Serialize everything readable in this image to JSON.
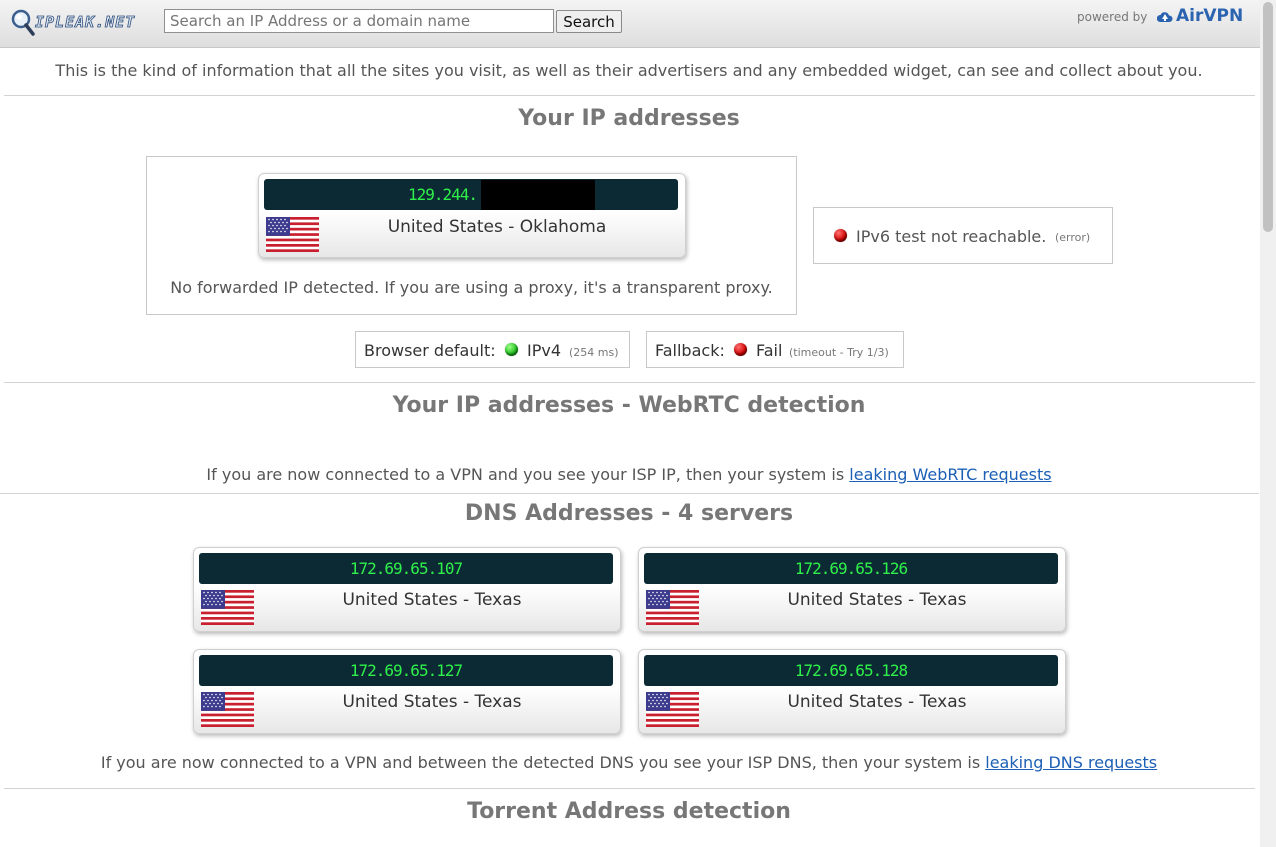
{
  "header": {
    "logo_text": "IPLEAK.NET",
    "search_placeholder": "Search an IP Address or a domain name",
    "search_button": "Search",
    "powered_by": "powered by",
    "brand": "AirVPN"
  },
  "intro": "This is the kind of information that all the sites you visit, as well as their advertisers and any embedded widget, can see and collect about you.",
  "ip_section": {
    "title": "Your IP addresses",
    "ip": "129.244.",
    "location": "United States - Oklahoma",
    "forwarded_note": "No forwarded IP detected. If you are using a proxy, it's a transparent proxy.",
    "ipv6_status": "IPv6 test not reachable.",
    "ipv6_detail": "(error)",
    "browser_default_label": "Browser default:",
    "browser_default_value": "IPv4",
    "browser_default_detail": "(254 ms)",
    "fallback_label": "Fallback:",
    "fallback_value": "Fail",
    "fallback_detail": "(timeout - Try 1/3)"
  },
  "webrtc_section": {
    "title": "Your IP addresses - WebRTC detection",
    "note": "If you are now connected to a VPN and you see your ISP IP, then your system is",
    "link": "leaking WebRTC requests"
  },
  "dns_section": {
    "title": "DNS Addresses - 4 servers",
    "servers": [
      {
        "ip": "172.69.65.107",
        "location": "United States - Texas"
      },
      {
        "ip": "172.69.65.126",
        "location": "United States - Texas"
      },
      {
        "ip": "172.69.65.127",
        "location": "United States - Texas"
      },
      {
        "ip": "172.69.65.128",
        "location": "United States - Texas"
      }
    ],
    "note": "If you are now connected to a VPN and between the detected DNS you see your ISP DNS, then your system is",
    "link": "leaking DNS requests"
  },
  "torrent_section": {
    "title": "Torrent Address detection"
  },
  "colors": {
    "ip_bar_bg": "#0b2a33",
    "ip_text": "#2ff04a",
    "link": "#1c5fb5",
    "status_ok": "#1dbe1d",
    "status_fail": "#d10000"
  },
  "icons": [
    "magnifier-logo-icon",
    "us-flag-icon",
    "red-status-dot-icon",
    "green-status-dot-icon",
    "airvpn-cloud-icon"
  ]
}
